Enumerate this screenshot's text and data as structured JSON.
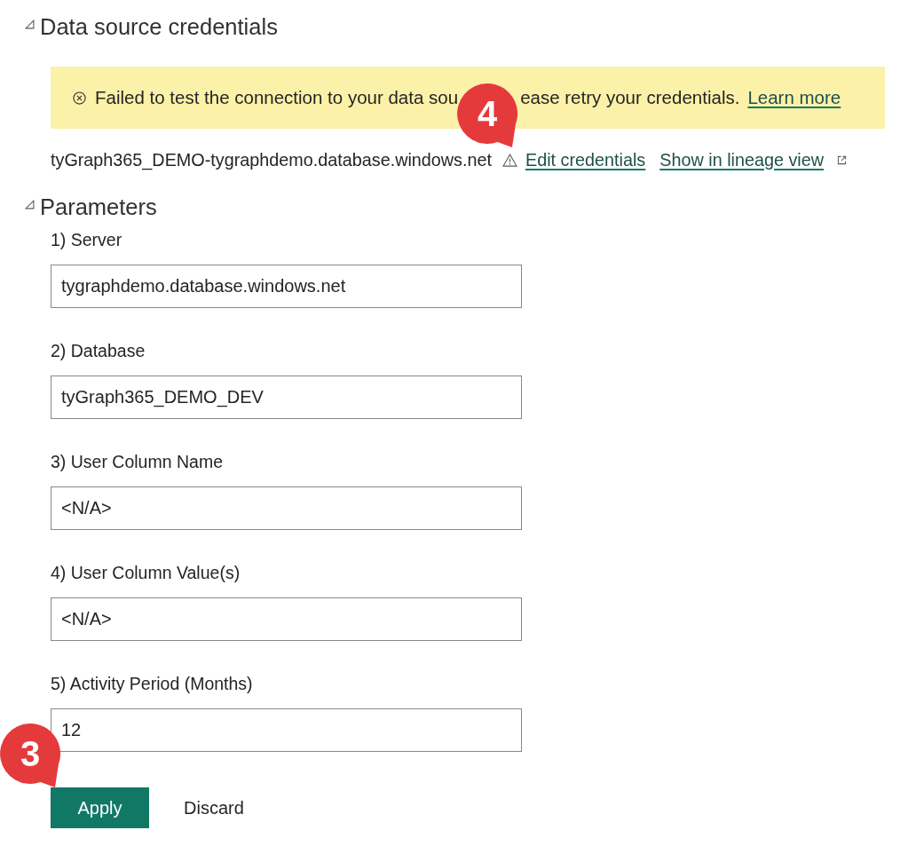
{
  "credentials": {
    "title": "Data source credentials",
    "expanded": true,
    "banner": {
      "message_start": "Failed to test the connection to your data sou",
      "message_end": "ease retry your credentials.",
      "link": "Learn more",
      "callout": "4"
    },
    "source": {
      "name": "tyGraph365_DEMO-tygraphdemo.database.windows.net",
      "warning": true,
      "links": [
        {
          "label": "Edit credentials",
          "external": false
        },
        {
          "label": "Show in lineage view",
          "external": true
        }
      ]
    }
  },
  "parameters": {
    "title": "Parameters",
    "expanded": true,
    "fields": [
      {
        "label": "1) Server",
        "value": "tygraphdemo.database.windows.net"
      },
      {
        "label": "2) Database",
        "value": "tyGraph365_DEMO_DEV"
      },
      {
        "label": "3) User Column Name",
        "value": "<N/A>"
      },
      {
        "label": "4) User Column Value(s)",
        "value": "<N/A>"
      },
      {
        "label": "5) Activity Period (Months)",
        "value": "12"
      }
    ],
    "buttons": [
      {
        "label": "Apply",
        "primary": true,
        "callout": "3"
      },
      {
        "label": "Discard",
        "primary": false
      }
    ]
  }
}
